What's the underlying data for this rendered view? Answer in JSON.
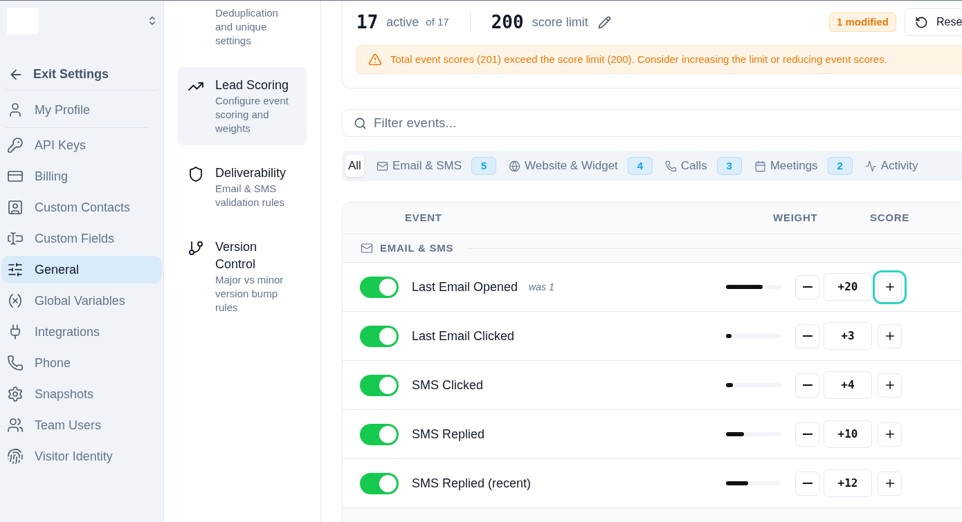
{
  "sidebar": {
    "exit": "Exit Settings",
    "items": [
      {
        "label": "My Profile",
        "selected": false
      },
      {
        "label": "API Keys",
        "selected": false
      },
      {
        "label": "Billing",
        "selected": false
      },
      {
        "label": "Custom Contacts",
        "selected": false
      },
      {
        "label": "Custom Fields",
        "selected": false
      },
      {
        "label": "General",
        "selected": true
      },
      {
        "label": "Global Variables",
        "selected": false
      },
      {
        "label": "Integrations",
        "selected": false
      },
      {
        "label": "Phone",
        "selected": false
      },
      {
        "label": "Snapshots",
        "selected": false
      },
      {
        "label": "Team Users",
        "selected": false
      },
      {
        "label": "Visitor Identity",
        "selected": false
      }
    ]
  },
  "subnav": [
    {
      "description": "Deduplication and unique settings",
      "selected": false
    },
    {
      "title": "Lead Scoring",
      "description": "Configure event scoring and weights",
      "selected": true
    },
    {
      "title": "Deliverability",
      "description": "Email & SMS validation rules",
      "selected": false
    },
    {
      "title": "Version Control",
      "description": "Major vs minor version bump rules",
      "selected": false
    }
  ],
  "summary": {
    "active": "17",
    "active_label": "active",
    "of": "of 17",
    "limit": "200",
    "limit_label": "score limit",
    "modified": "1 modified",
    "reset": "Rese"
  },
  "alert": "Total event scores (201) exceed the score limit (200). Consider increasing the limit or reducing event scores.",
  "filter": {
    "placeholder": "Filter events..."
  },
  "tabs": [
    {
      "label": "All",
      "selected": true
    },
    {
      "label": "Email & SMS",
      "count": "5",
      "selected": false
    },
    {
      "label": "Website & Widget",
      "count": "4",
      "selected": false
    },
    {
      "label": "Calls",
      "count": "3",
      "selected": false
    },
    {
      "label": "Meetings",
      "count": "2",
      "selected": false
    },
    {
      "label": "Activity",
      "selected": false
    }
  ],
  "table": {
    "columns": [
      "EVENT",
      "WEIGHT",
      "SCORE"
    ],
    "sections": [
      {
        "title": "EMAIL & SMS",
        "rows": [
          {
            "name": "Last Email Opened",
            "note": "was 1",
            "on": true,
            "level": 0.66,
            "score": "+20",
            "highlighted": true
          },
          {
            "name": "Last Email Clicked",
            "on": true,
            "level": 0.1,
            "score": "+3",
            "highlighted": false
          },
          {
            "name": "SMS Clicked",
            "on": true,
            "level": 0.12,
            "score": "+4",
            "highlighted": false
          },
          {
            "name": "SMS Replied",
            "on": true,
            "level": 0.32,
            "score": "+10",
            "highlighted": false
          },
          {
            "name": "SMS Replied (recent)",
            "on": true,
            "level": 0.4,
            "score": "+12",
            "highlighted": false
          }
        ]
      }
    ]
  }
}
